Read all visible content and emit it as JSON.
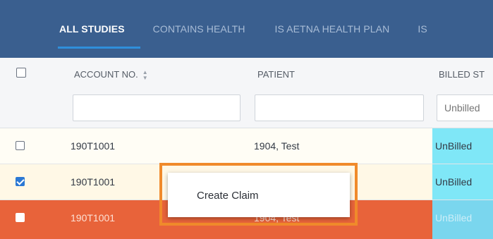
{
  "tabs": [
    {
      "label": "ALL STUDIES",
      "active": true
    },
    {
      "label": "CONTAINS HEALTH",
      "active": false
    },
    {
      "label": "IS AETNA HEALTH PLAN",
      "active": false
    },
    {
      "label": "IS",
      "active": false
    }
  ],
  "columns": {
    "account": "ACCOUNT NO.",
    "patient": "PATIENT",
    "billed_status": "BILLED ST"
  },
  "filters": {
    "account": "",
    "patient": "",
    "billed_status_placeholder": "Unbilled"
  },
  "rows": [
    {
      "account": "190T1001",
      "patient": "1904, Test",
      "status": "UnBilled",
      "checked": false,
      "selected": false
    },
    {
      "account": "190T1001",
      "patient": "",
      "status": "UnBilled",
      "checked": true,
      "selected": false
    },
    {
      "account": "190T1001",
      "patient": "1904, Test",
      "status": "UnBilled",
      "checked": false,
      "selected": true
    }
  ],
  "context_menu": {
    "items": [
      "Create Claim"
    ]
  },
  "colors": {
    "tabbar": "#3a5f8f",
    "tab_indicator": "#2f8fdb",
    "selected_row": "#e8633a",
    "status_cell": "#7fe7f7",
    "menu_highlight": "#f08a2b"
  },
  "icons": {
    "sort": "sort-asc-icon",
    "checkbox": "checkbox-icon"
  }
}
